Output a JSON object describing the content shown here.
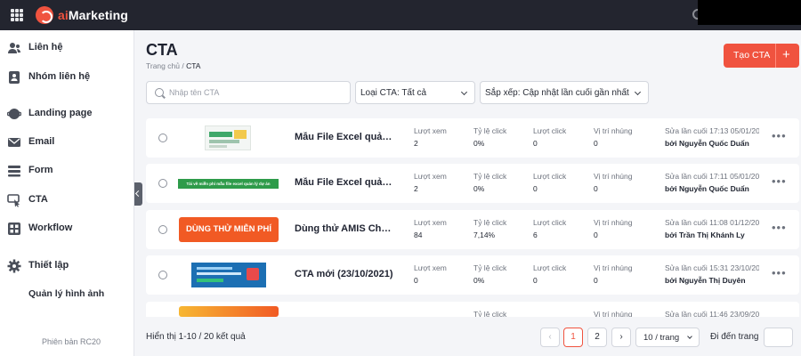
{
  "app": {
    "brand_ai": "ai",
    "brand_rest": "Marketing"
  },
  "sidebar": {
    "items": [
      {
        "label": "Liên hệ",
        "icon": "contacts-icon"
      },
      {
        "label": "Nhóm liên hệ",
        "icon": "contact-group-icon"
      },
      {
        "label": "Landing page",
        "icon": "landing-page-icon"
      },
      {
        "label": "Email",
        "icon": "email-icon"
      },
      {
        "label": "Form",
        "icon": "form-icon"
      },
      {
        "label": "CTA",
        "icon": "cta-icon"
      },
      {
        "label": "Workflow",
        "icon": "workflow-icon"
      },
      {
        "label": "Thiết lập",
        "icon": "gear-icon"
      }
    ],
    "sub_item": "Quản lý hình ảnh",
    "version": "Phiên bản RC20"
  },
  "page": {
    "title": "CTA",
    "breadcrumb_home": "Trang chủ",
    "breadcrumb_sep": " / ",
    "breadcrumb_current": "CTA",
    "create_label": "Tạo CTA",
    "create_plus": "+"
  },
  "filters": {
    "search_placeholder": "Nhập tên CTA",
    "type_select": "Loại CTA: Tất cả",
    "sort_select": "Sắp xếp: Cập nhật lần cuối gần nhất"
  },
  "columns": {
    "views": "Lượt xem",
    "ctr": "Tỷ lệ click",
    "clicks": "Lượt click",
    "embed": "Vị trí nhúng"
  },
  "rows": [
    {
      "name": "Mẫu File Excel quản lý dự án",
      "views": "2",
      "ctr": "0%",
      "clicks": "0",
      "embed": "0",
      "edited": "Sửa lần cuối 17:13 05/01/2022",
      "by": "bởi Nguyễn Quốc Duẩn"
    },
    {
      "name": "Mẫu File Excel quản lý dự án",
      "views": "2",
      "ctr": "0%",
      "clicks": "0",
      "embed": "0",
      "edited": "Sửa lần cuối 17:11 05/01/2022",
      "by": "bởi Nguyễn Quốc Duẩn",
      "thumb_text": "Tải về miễn phí mẫu file excel quản lý dự án"
    },
    {
      "name": "Dùng thử AMIS Chấm công",
      "views": "84",
      "ctr": "7,14%",
      "clicks": "6",
      "embed": "0",
      "edited": "Sửa lần cuối 11:08 01/12/2021",
      "by": "bởi Trần Thị Khánh Ly",
      "thumb_text": "DÙNG THỬ MIỄN PHÍ"
    },
    {
      "name": "CTA mới (23/10/2021)",
      "views": "0",
      "ctr": "0%",
      "clicks": "0",
      "embed": "0",
      "edited": "Sửa lần cuối 15:31 23/10/2021",
      "by": "bởi Nguyễn Thị Duyên"
    },
    {
      "edited": "Sửa lần cuối 11:46 23/09/2021"
    }
  ],
  "footer": {
    "showing": "Hiển thị 1-10 / 20 kết quả",
    "prev": "‹",
    "page1": "1",
    "page2": "2",
    "next": "›",
    "per_page": "10 / trang",
    "goto_label": "Đi đến trang"
  }
}
